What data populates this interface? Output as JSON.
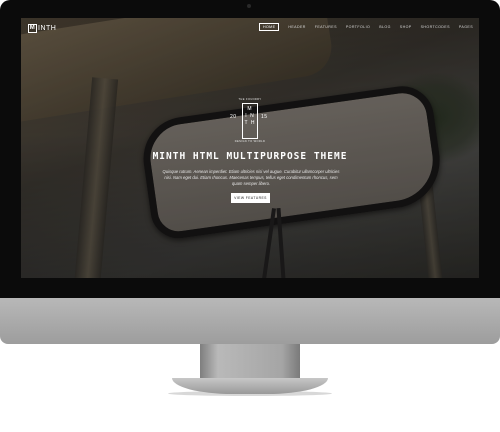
{
  "nav": {
    "logo_letter": "M",
    "logo_rest": "INTH",
    "items": [
      {
        "label": "Home",
        "active": true
      },
      {
        "label": "Header"
      },
      {
        "label": "Features"
      },
      {
        "label": "Portfolio"
      },
      {
        "label": "Blog"
      },
      {
        "label": "Shop"
      },
      {
        "label": "Shortcodes"
      },
      {
        "label": "Pages"
      }
    ]
  },
  "hero": {
    "mark_top": "THE FOUNDRY",
    "mark_letters": [
      "M",
      "I N",
      "T H"
    ],
    "year_left": "20",
    "year_right": "15",
    "mark_bottom": "DESIGN TO WORLD",
    "title": "MINTH HTML MULTIPURPOSE THEME",
    "text": "Quisque rutrum. Aenean imperdiet. Etiam ultricies nisi vel augue. Curabitur ullamcorper ultricies nisi. Nam eget dui. Etiam rhoncus. Maecenas tempus, tellus eget condimentum rhoncus, sem quam semper libero.",
    "button_label": "VIEW FEATURES"
  }
}
